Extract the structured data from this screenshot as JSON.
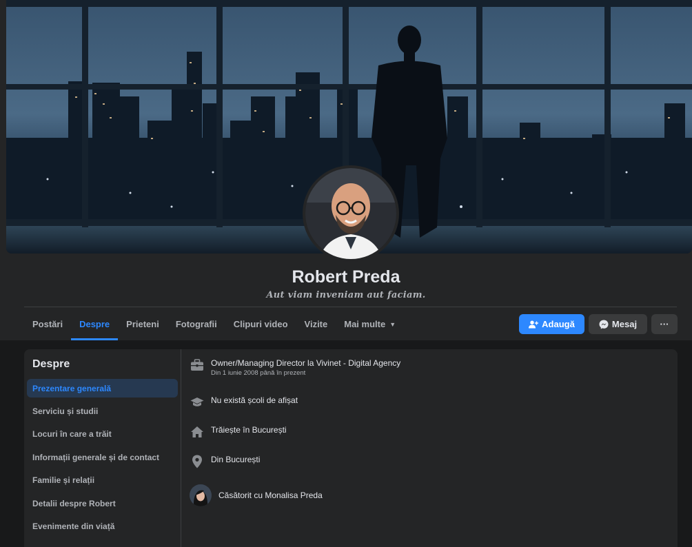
{
  "profile": {
    "name": "Robert Preda",
    "motto": "Aut viam inveniam aut faciam."
  },
  "tabs": [
    {
      "label": "Postări"
    },
    {
      "label": "Despre"
    },
    {
      "label": "Prieteni"
    },
    {
      "label": "Fotografii"
    },
    {
      "label": "Clipuri video"
    },
    {
      "label": "Vizite"
    },
    {
      "label": "Mai multe"
    }
  ],
  "actions": {
    "add_label": "Adaugă",
    "message_label": "Mesaj",
    "more_label": "···"
  },
  "about": {
    "title": "Despre",
    "sidebar": [
      {
        "label": "Prezentare generală"
      },
      {
        "label": "Serviciu și studii"
      },
      {
        "label": "Locuri în care a trăit"
      },
      {
        "label": "Informații generale și de contact"
      },
      {
        "label": "Familie și relații"
      },
      {
        "label": "Detalii despre Robert"
      },
      {
        "label": "Evenimente din viață"
      }
    ],
    "rows": {
      "work": {
        "text": "Owner/Managing Director la Vivinet - Digital Agency",
        "sub": "Din 1 iunie 2008 până în prezent"
      },
      "school": {
        "text": "Nu există școli de afișat"
      },
      "lives": {
        "text": "Trăiește în București"
      },
      "from": {
        "text": "Din București"
      },
      "relationship": {
        "text": "Căsătorit cu Monalisa Preda"
      }
    }
  },
  "colors": {
    "accent": "#2d88ff",
    "background": "#18191a",
    "card": "#242526"
  }
}
